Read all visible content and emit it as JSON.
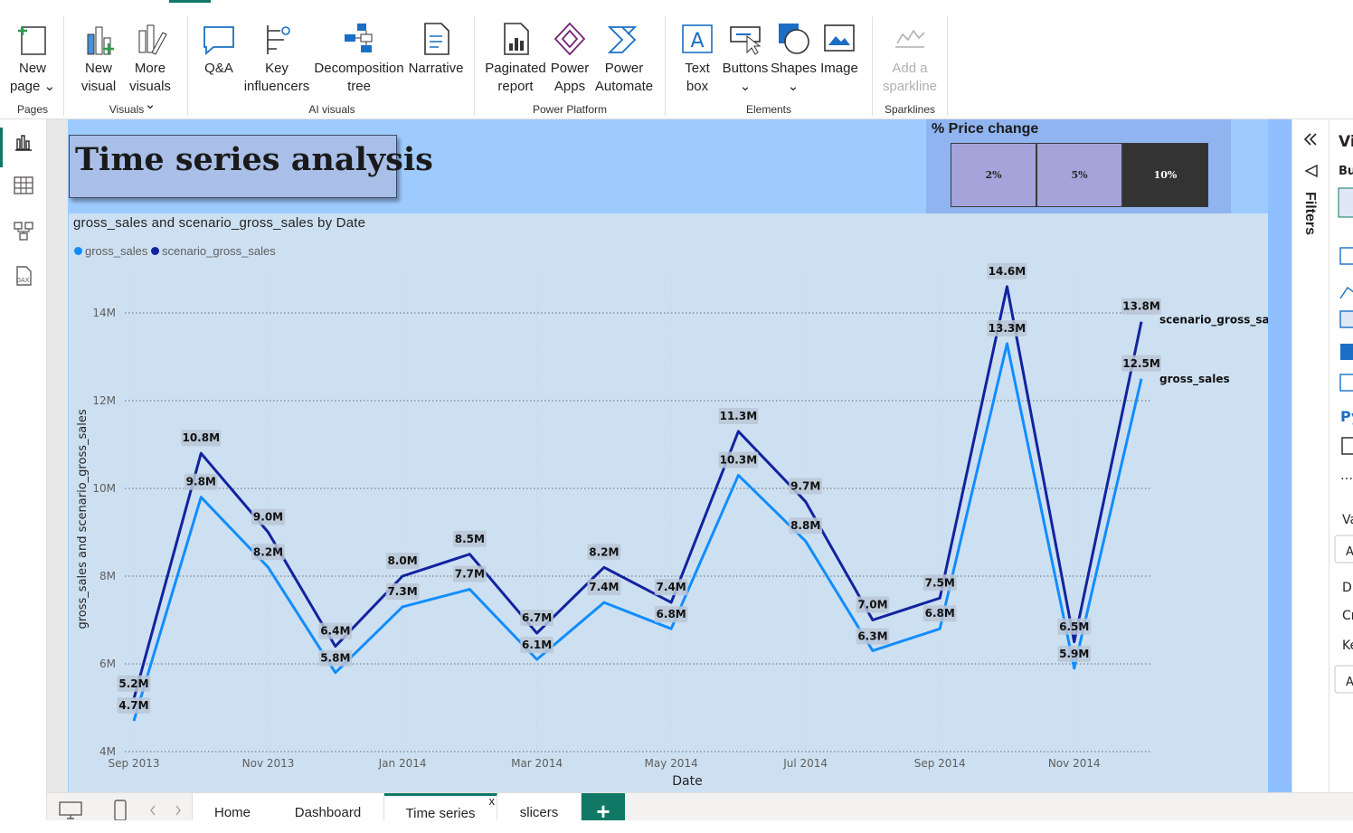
{
  "ribbon": {
    "buttons": [
      {
        "id": "new-page",
        "line1": "New",
        "line2": "page ⌄"
      },
      {
        "id": "new-visual",
        "line1": "New",
        "line2": "visual"
      },
      {
        "id": "more-visuals",
        "line1": "More",
        "line2": "visuals ⌄"
      },
      {
        "id": "qna",
        "line1": "Q&A",
        "line2": ""
      },
      {
        "id": "key-influencers",
        "line1": "Key",
        "line2": "influencers"
      },
      {
        "id": "decomposition-tree",
        "line1": "Decomposition",
        "line2": "tree"
      },
      {
        "id": "narrative",
        "line1": "Narrative",
        "line2": ""
      },
      {
        "id": "paginated-report",
        "line1": "Paginated",
        "line2": "report"
      },
      {
        "id": "power-apps",
        "line1": "Power",
        "line2": "Apps"
      },
      {
        "id": "power-automate",
        "line1": "Power",
        "line2": "Automate"
      },
      {
        "id": "text-box",
        "line1": "Text",
        "line2": "box"
      },
      {
        "id": "buttons",
        "line1": "Buttons",
        "line2": "⌄"
      },
      {
        "id": "shapes",
        "line1": "Shapes",
        "line2": "⌄"
      },
      {
        "id": "image",
        "line1": "Image",
        "line2": ""
      },
      {
        "id": "add-sparkline",
        "line1": "Add a",
        "line2": "sparkline"
      }
    ],
    "groups": {
      "pages": "Pages",
      "visuals": "Visuals",
      "ai": "AI visuals",
      "platform": "Power Platform",
      "elements": "Elements",
      "sparklines": "Sparklines"
    }
  },
  "report": {
    "title": "Time series analysis",
    "slicer": {
      "title": "% Price change",
      "options": [
        {
          "label": "2%",
          "selected": false
        },
        {
          "label": "5%",
          "selected": false
        },
        {
          "label": "10%",
          "selected": true
        }
      ]
    }
  },
  "chart": {
    "title": "gross_sales and scenario_gross_sales by Date",
    "legend": [
      {
        "name": "gross_sales",
        "color": "#118dff"
      },
      {
        "name": "scenario_gross_sales",
        "color": "#12239e"
      }
    ]
  },
  "chart_data": {
    "type": "line",
    "x": [
      "Sep 2013",
      "Oct 2013",
      "Nov 2013",
      "Dec 2013",
      "Jan 2014",
      "Feb 2014",
      "Mar 2014",
      "Apr 2014",
      "May 2014",
      "Jun 2014",
      "Jul 2014",
      "Aug 2014",
      "Sep 2014",
      "Oct 2014",
      "Nov 2014",
      "Dec 2014"
    ],
    "x_tick_labels": [
      "Sep 2013",
      "Nov 2013",
      "Jan 2014",
      "Mar 2014",
      "May 2014",
      "Jul 2014",
      "Sep 2014",
      "Nov 2014"
    ],
    "series": [
      {
        "name": "gross_sales",
        "color": "#118dff",
        "values": [
          4.7,
          9.8,
          8.2,
          5.8,
          7.3,
          7.7,
          6.1,
          7.4,
          6.8,
          10.3,
          8.8,
          6.3,
          6.8,
          13.3,
          5.9,
          12.5
        ],
        "labels": [
          "4.7M",
          "9.8M",
          "8.2M",
          "5.8M",
          "7.3M",
          "7.7M",
          "6.1M",
          "7.4M",
          "6.8M",
          "10.3M",
          "8.8M",
          "6.3M",
          "6.8M",
          "13.3M",
          "5.9M",
          "12.5M"
        ]
      },
      {
        "name": "scenario_gross_sales",
        "color": "#12239e",
        "values": [
          5.2,
          10.8,
          9.0,
          6.4,
          8.0,
          8.5,
          6.7,
          8.2,
          7.4,
          11.3,
          9.7,
          7.0,
          7.5,
          14.6,
          6.5,
          13.8
        ],
        "labels": [
          "5.2M",
          "10.8M",
          "9.0M",
          "6.4M",
          "8.0M",
          "8.5M",
          "6.7M",
          "8.2M",
          "7.4M",
          "11.3M",
          "9.7M",
          "7.0M",
          "7.5M",
          "14.6M",
          "6.5M",
          "13.8M"
        ]
      }
    ],
    "y_ticks": [
      4,
      6,
      8,
      10,
      12,
      14
    ],
    "y_tick_labels": [
      "4M",
      "6M",
      "8M",
      "10M",
      "12M",
      "14M"
    ],
    "ylim": [
      4,
      15
    ],
    "xlabel": "Date",
    "ylabel": "gross_sales and scenario_gross_sales",
    "grid": true,
    "legend_position": "top-left"
  },
  "pagebar": {
    "tabs": [
      {
        "label": "Home",
        "active": false
      },
      {
        "label": "Dashboard",
        "active": false
      },
      {
        "label": "Time series",
        "active": true
      },
      {
        "label": "slicers",
        "active": false
      }
    ],
    "add_label": "+",
    "close_label": "x"
  },
  "rightpane": {
    "filters_label": "Filters"
  }
}
